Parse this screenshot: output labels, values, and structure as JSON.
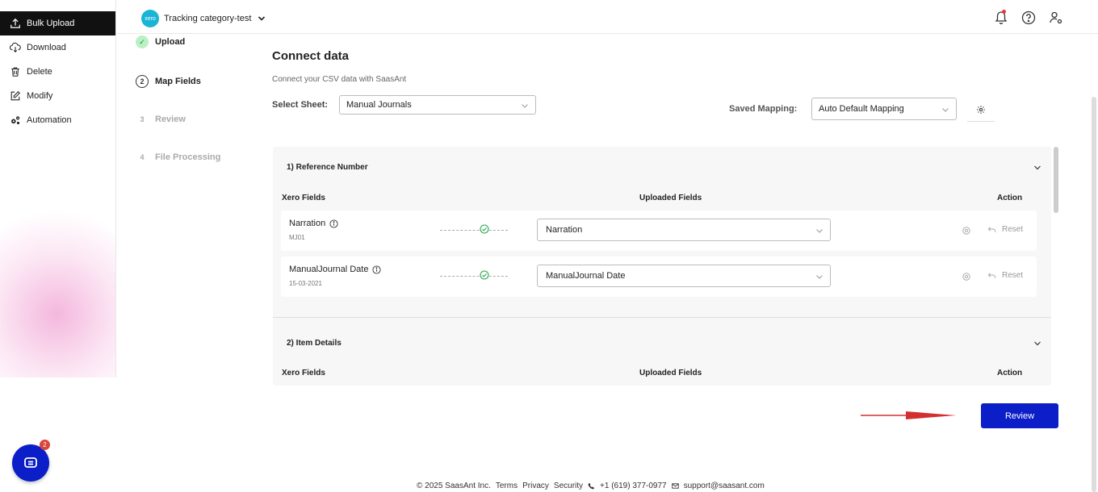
{
  "nav": {
    "items": [
      {
        "label": "Bulk Upload",
        "icon": "upload-icon"
      },
      {
        "label": "Download",
        "icon": "cloud-download-icon"
      },
      {
        "label": "Delete",
        "icon": "trash-icon"
      },
      {
        "label": "Modify",
        "icon": "edit-icon"
      },
      {
        "label": "Automation",
        "icon": "gears-icon"
      }
    ]
  },
  "header": {
    "logo_text": "xero",
    "org_name": "Tracking category-test"
  },
  "steps": [
    {
      "num": "✓",
      "label": "Upload"
    },
    {
      "num": "2",
      "label": "Map Fields"
    },
    {
      "num": "3",
      "label": "Review"
    },
    {
      "num": "4",
      "label": "File Processing"
    }
  ],
  "main": {
    "title": "Connect data",
    "subtitle": "Connect your CSV data with SaasAnt",
    "sheet_label": "Select Sheet:",
    "sheet_value": "Manual Journals",
    "mapping_label": "Saved Mapping:",
    "mapping_value": "Auto Default Mapping"
  },
  "sections": [
    {
      "title": "1) Reference Number",
      "col_xero": "Xero Fields",
      "col_uploaded": "Uploaded Fields",
      "col_action": "Action",
      "rows": [
        {
          "field": "Narration",
          "sample": "MJ01",
          "uploaded": "Narration",
          "reset": "Reset"
        },
        {
          "field": "ManualJournal Date",
          "sample": "15-03-2021",
          "uploaded": "ManualJournal Date",
          "reset": "Reset"
        }
      ]
    },
    {
      "title": "2) Item Details",
      "col_xero": "Xero Fields",
      "col_uploaded": "Uploaded Fields",
      "col_action": "Action"
    }
  ],
  "review_label": "Review",
  "chat_badge": "2",
  "footer": {
    "copyright": "© 2025 SaasAnt Inc.",
    "terms": "Terms",
    "privacy": "Privacy",
    "security": "Security",
    "phone": "+1 (619) 377-0977",
    "email": "support@saasant.com"
  },
  "colors": {
    "primary": "#0b1ec7",
    "nav_active": "#111111",
    "step_done": "#b9f0c5",
    "success": "#2fa84f",
    "arrow": "#d32f2f",
    "xero": "#1ab4d7"
  }
}
